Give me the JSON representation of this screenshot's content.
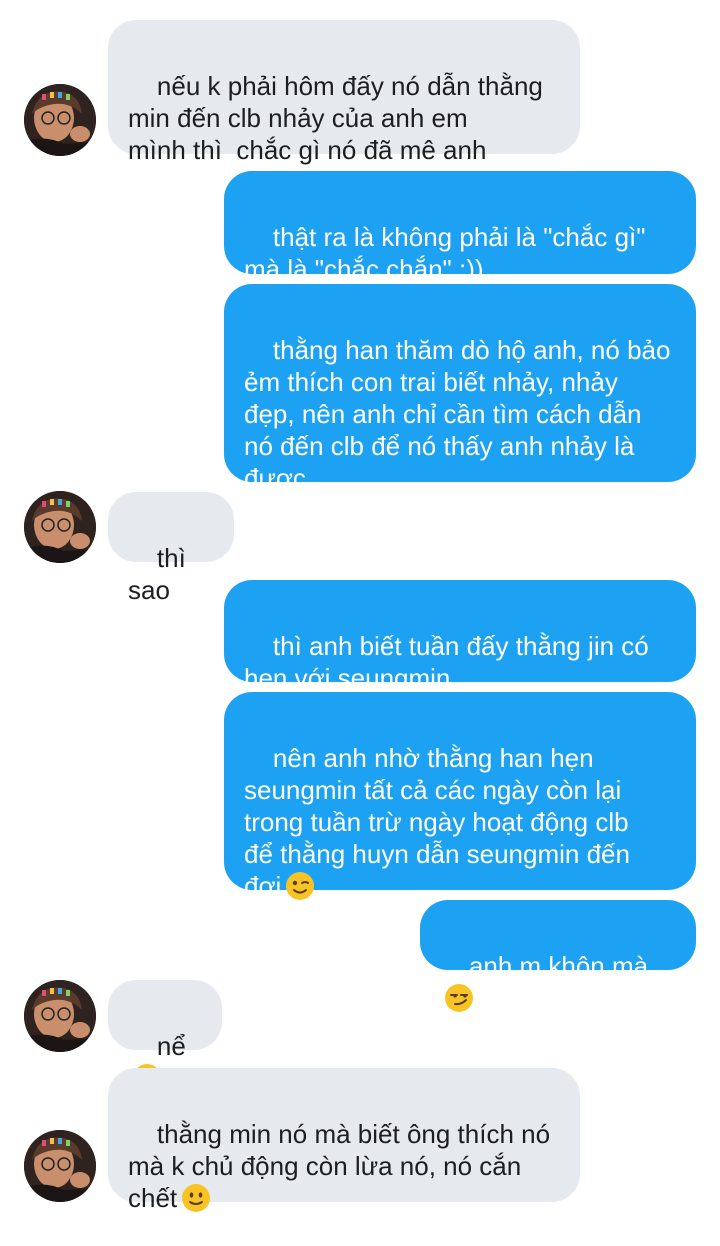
{
  "conversation": {
    "messages": [
      {
        "sender": "them",
        "text": "nếu k phải hôm đấy nó dẫn thằng\nmin đến clb nhảy của anh em\nmình thì  chắc gì nó đã mê anh"
      },
      {
        "sender": "me",
        "text": "thật ra là không phải là \"chắc gì\"\nmà là \"chắc chắn\" :))"
      },
      {
        "sender": "me",
        "text": "thằng han thăm dò hộ anh, nó bảo\nẻm thích con trai biết nhảy, nhảy\nđẹp, nên anh chỉ cần tìm cách dẫn\nnó đến clb để nó thấy anh nhảy là\nđược"
      },
      {
        "sender": "them",
        "text": "thì sao"
      },
      {
        "sender": "me",
        "text": "thì anh biết tuần đấy thằng jin có\nhẹn với seungmin"
      },
      {
        "sender": "me",
        "text": "nên anh nhờ thằng han hẹn\nseungmin tất cả các ngày còn lại\ntrong tuần trừ ngày hoạt động clb\nđể thằng huyn dẫn seungmin đến\nđợi",
        "emoji": "winking-face"
      },
      {
        "sender": "me",
        "text": "anh m khôn mà",
        "emoji": "smirking-face"
      },
      {
        "sender": "them",
        "text": "nể",
        "emoji": "smiling-face"
      },
      {
        "sender": "them",
        "text": "thằng min nó mà biết ông thích nó\nmà k chủ động còn lừa nó, nó cắn\nchết",
        "emoji": "slightly-smiling-face"
      }
    ]
  },
  "colors": {
    "incoming_bubble": "#e6eaee",
    "outgoing_bubble": "#1da1f2",
    "incoming_text": "#1c1e21",
    "outgoing_text": "#ffffff",
    "emoji_yellow": "#f7c325"
  }
}
